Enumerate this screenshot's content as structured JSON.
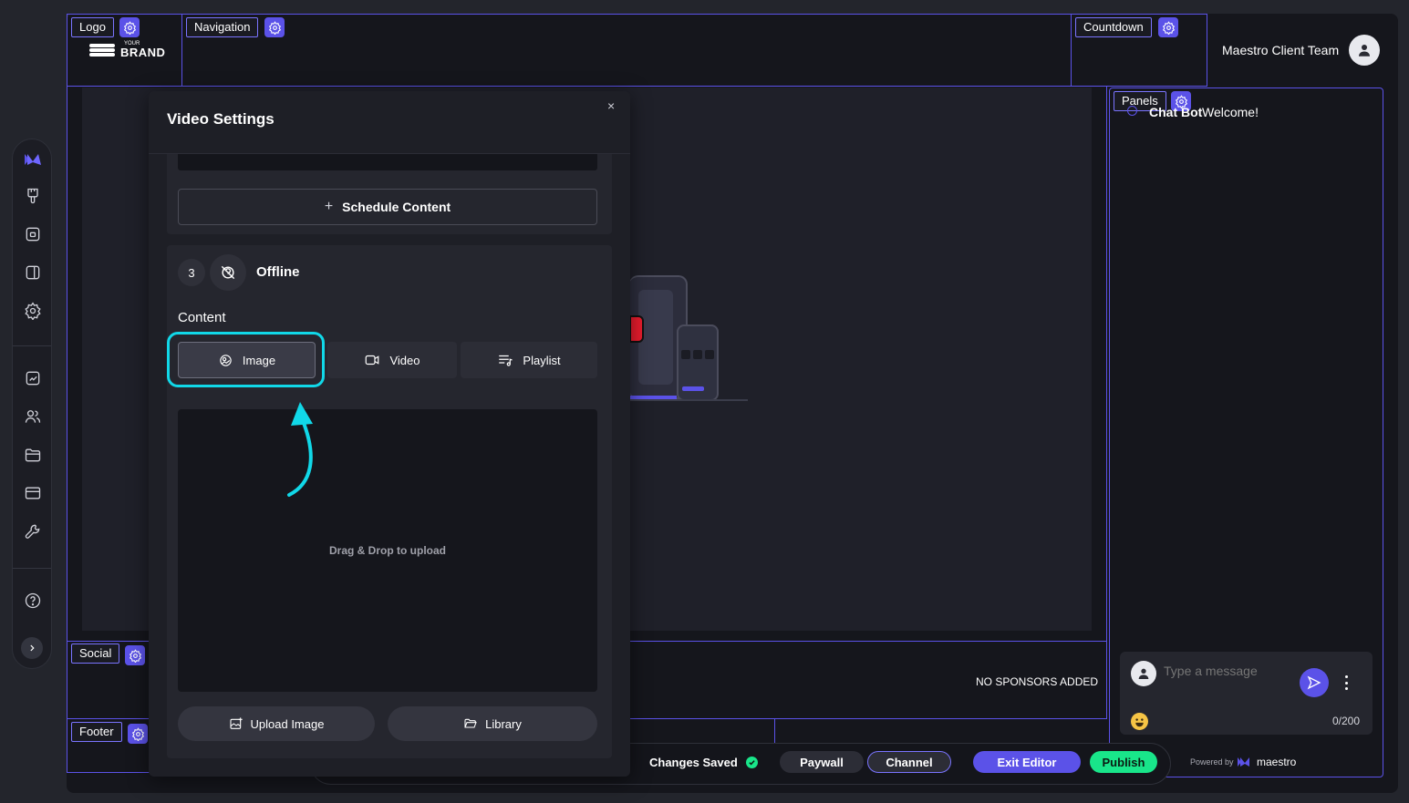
{
  "regions": {
    "logo_tag": "Logo",
    "navigation_tag": "Navigation",
    "countdown_tag": "Countdown",
    "panels_tag": "Panels",
    "social_tag": "Social",
    "footer_tag": "Footer"
  },
  "brand": {
    "small": "YOUR",
    "large": "BRAND"
  },
  "user": {
    "name": "Maestro Client Team"
  },
  "modal": {
    "title": "Video Settings",
    "close": "×",
    "schedule_label": "Schedule Content",
    "schedule_icon": "+",
    "step_number": "3",
    "step_title": "Offline",
    "content_label": "Content",
    "tabs": [
      {
        "label": "Image",
        "icon": "image-icon",
        "selected": true
      },
      {
        "label": "Video",
        "icon": "video-icon"
      },
      {
        "label": "Playlist",
        "icon": "playlist-icon"
      }
    ],
    "dropzone_text": "Drag & Drop to upload",
    "upload_label": "Upload Image",
    "library_label": "Library"
  },
  "panel": {
    "chat_bot": "Chat Bot",
    "welcome": "Welcome!",
    "message_placeholder": "Type a message",
    "char_count": "0/200",
    "powered_by": "Powered by",
    "maestro": "maestro"
  },
  "sponsors": {
    "empty": "NO SPONSORS ADDED"
  },
  "toolbar": {
    "status": "Changes Saved",
    "paywall": "Paywall",
    "channel": "Channel",
    "exit": "Exit Editor",
    "publish": "Publish"
  },
  "colors": {
    "accent": "#5b52e8",
    "highlight": "#11d8e8",
    "publish": "#19e58a",
    "background": "#15161c"
  }
}
